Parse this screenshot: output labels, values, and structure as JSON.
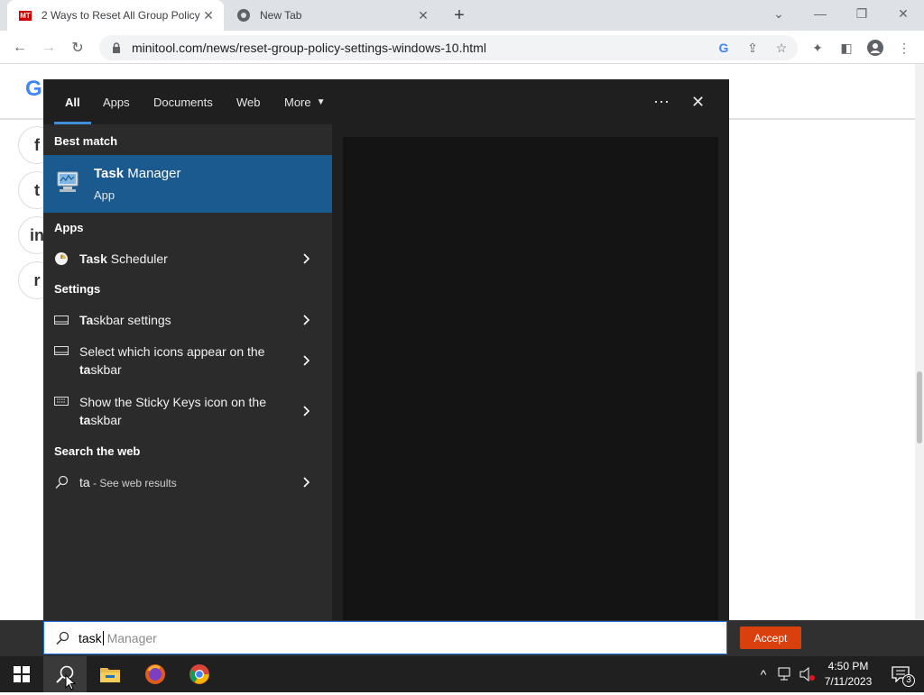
{
  "browser": {
    "tabs": [
      {
        "title": "2 Ways to Reset All Group Policy",
        "favicon": "MT",
        "active": true
      },
      {
        "title": "New Tab",
        "active": false
      }
    ],
    "url": "minitool.com/news/reset-group-policy-settings-windows-10.html"
  },
  "search_panel": {
    "tabs": [
      "All",
      "Apps",
      "Documents",
      "Web",
      "More"
    ],
    "best_match_header": "Best match",
    "best_match": {
      "title_bold": "Task",
      "title_rest": " Manager",
      "subtitle": "App"
    },
    "apps_header": "Apps",
    "apps": [
      {
        "bold": "Task",
        "rest": " Scheduler"
      }
    ],
    "settings_header": "Settings",
    "settings": [
      {
        "bold": "Ta",
        "rest": "skbar settings"
      },
      {
        "line1": "Select which icons appear on the",
        "bold": "ta",
        "rest": "skbar"
      },
      {
        "line1": "Show the Sticky Keys icon on the",
        "bold": "ta",
        "rest": "skbar"
      }
    ],
    "web_header": "Search the web",
    "web": {
      "query": "ta",
      "suffix": " - See web results"
    },
    "search_box": {
      "typed": "task",
      "suggestion": " Manager"
    }
  },
  "cookie": {
    "accept_label": "Accept"
  },
  "taskbar": {
    "time": "4:50 PM",
    "date": "7/11/2023",
    "notification_count": "3"
  },
  "colors": {
    "accent": "#1a5a8f",
    "accept": "#d9400d"
  }
}
